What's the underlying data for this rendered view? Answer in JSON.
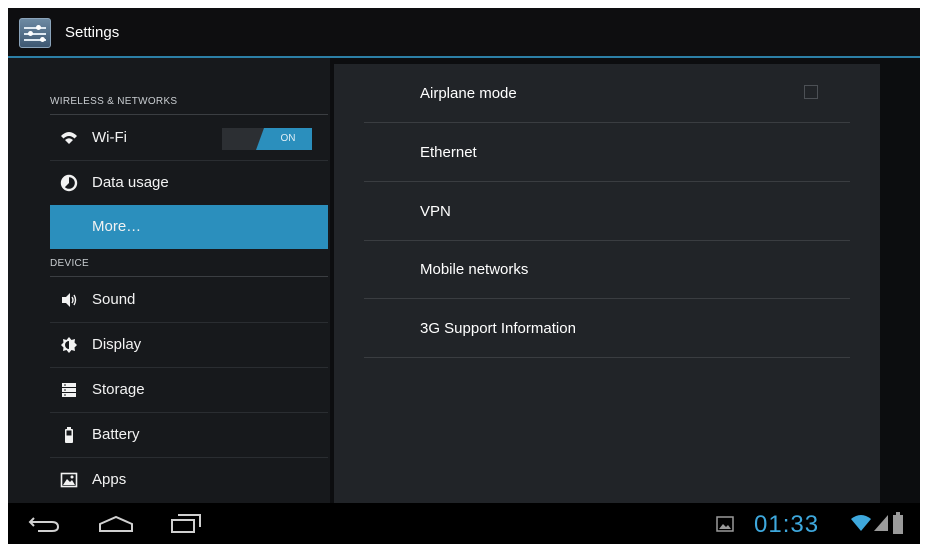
{
  "app": {
    "title": "Settings",
    "icon": "settings-sliders-icon"
  },
  "sidebar": {
    "sections": [
      {
        "header": "WIRELESS & NETWORKS",
        "items": [
          {
            "label": "Wi-Fi",
            "icon": "wifi-icon",
            "toggle": "ON"
          },
          {
            "label": "Data usage",
            "icon": "data-usage-icon"
          },
          {
            "label": "More…",
            "selected": true
          }
        ]
      },
      {
        "header": "DEVICE",
        "items": [
          {
            "label": "Sound",
            "icon": "speaker-icon"
          },
          {
            "label": "Display",
            "icon": "brightness-icon"
          },
          {
            "label": "Storage",
            "icon": "storage-icon"
          },
          {
            "label": "Battery",
            "icon": "battery-icon"
          },
          {
            "label": "Apps",
            "icon": "apps-icon"
          }
        ]
      }
    ]
  },
  "main": {
    "items": [
      {
        "label": "Airplane mode",
        "checkbox": false
      },
      {
        "label": "Ethernet"
      },
      {
        "label": "VPN"
      },
      {
        "label": "Mobile networks"
      },
      {
        "label": "3G Support Information"
      }
    ]
  },
  "status_bar": {
    "time": "01:33",
    "icons": [
      "screenshot-icon",
      "wifi-signal-icon",
      "cell-signal-icon",
      "battery-status-icon"
    ]
  },
  "navigation": {
    "icons": [
      "back-icon",
      "home-icon",
      "recent-apps-icon"
    ]
  },
  "colors": {
    "accent": "#2b8fbd",
    "clock": "#3ea8dd",
    "background": "#0c0d0f"
  }
}
